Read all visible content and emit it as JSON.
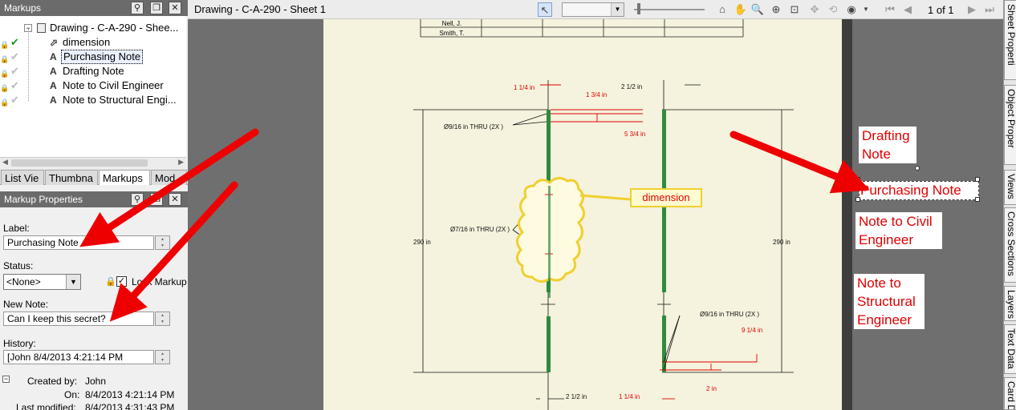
{
  "markups_panel": {
    "title": "Markups",
    "tree": {
      "root": "Drawing - C-A-290 - Shee...",
      "items": [
        {
          "label": "dimension",
          "glyph": "⬀",
          "checked": true
        },
        {
          "label": "Purchasing Note",
          "glyph": "A",
          "checked": false,
          "selected": true
        },
        {
          "label": "Drafting Note",
          "glyph": "A",
          "checked": false
        },
        {
          "label": "Note to Civil Engineer",
          "glyph": "A",
          "checked": false
        },
        {
          "label": "Note to Structural Engi...",
          "glyph": "A",
          "checked": false
        }
      ]
    },
    "tabs": [
      "List Vie",
      "Thumbna",
      "Markups",
      "Mod"
    ],
    "active_tab": "Markups"
  },
  "properties_panel": {
    "title": "Markup Properties",
    "label_caption": "Label:",
    "label_value": "Purchasing Note",
    "status_caption": "Status:",
    "status_value": "<None>",
    "lock_caption": "Lock Markup",
    "lock_checked": true,
    "new_note_caption": "New Note:",
    "new_note_value": "Can I keep this secret?",
    "history_caption": "History:",
    "history_value": "[John  8/4/2013  4:21:14 PM",
    "created_by_caption": "Created by:",
    "created_by_value": "John",
    "on_caption": "On:",
    "on_value": "8/4/2013  4:21:14 PM",
    "modified_caption": "Last modified:",
    "modified_value": "8/4/2013  4:31:43 PM"
  },
  "document": {
    "title": "Drawing - C-A-290 - Sheet 1",
    "page_indicator": "1 of 1"
  },
  "drawing": {
    "table_names": [
      "Nell, J.",
      "Smith, T."
    ],
    "dim_left_top": "1 1/4 in",
    "dim_right_top": "2 1/2 in",
    "dim_a": "1 3/4 in",
    "dim_b": "5 3/4 in",
    "hole_top": "Ø9/16 in THRU (2X )",
    "hole_mid": "Ø7/16 in THRU (2X )",
    "hole_bottom": "Ø9/16 in THRU (2X )",
    "height_left": "290 in",
    "height_right": "290 in",
    "dim_c": "9 1/4 in",
    "dim_d": "2 in",
    "dim_left_bottom": "2 1/2 in",
    "dim_right_bottom": "1 1/4 in",
    "dimension_label": "dimension"
  },
  "markup_notes": {
    "drafting": "Drafting Note",
    "purchasing": "Purchasing Note",
    "civil": "Note to Civil Engineer",
    "structural": "Note to Structural Engineer"
  },
  "side_tabs": [
    "Sheet Properti",
    "Object Proper",
    "Views",
    "Cross Sections",
    "Layers",
    "Text Data",
    "Card Data"
  ],
  "colors": {
    "markup_red": "#e00000",
    "sheet_bg": "#f5f2dd",
    "steel_green": "#2e8b3e",
    "cloud_yellow": "#f0d030"
  }
}
